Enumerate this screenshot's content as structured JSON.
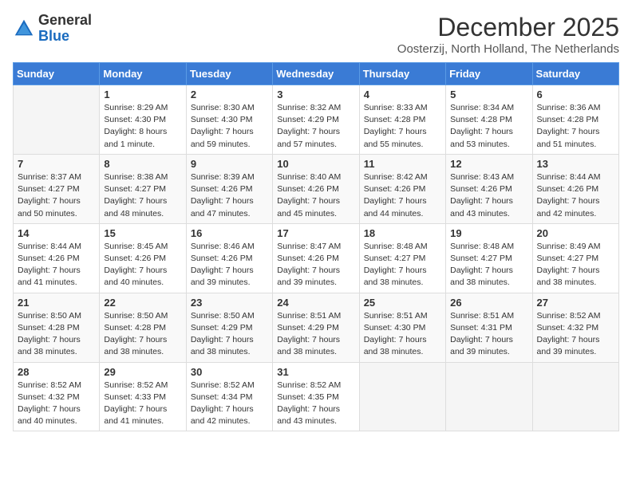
{
  "logo": {
    "general": "General",
    "blue": "Blue"
  },
  "header": {
    "month": "December 2025",
    "location": "Oosterzij, North Holland, The Netherlands"
  },
  "weekdays": [
    "Sunday",
    "Monday",
    "Tuesday",
    "Wednesday",
    "Thursday",
    "Friday",
    "Saturday"
  ],
  "weeks": [
    [
      {
        "day": "",
        "info": ""
      },
      {
        "day": "1",
        "info": "Sunrise: 8:29 AM\nSunset: 4:30 PM\nDaylight: 8 hours\nand 1 minute."
      },
      {
        "day": "2",
        "info": "Sunrise: 8:30 AM\nSunset: 4:30 PM\nDaylight: 7 hours\nand 59 minutes."
      },
      {
        "day": "3",
        "info": "Sunrise: 8:32 AM\nSunset: 4:29 PM\nDaylight: 7 hours\nand 57 minutes."
      },
      {
        "day": "4",
        "info": "Sunrise: 8:33 AM\nSunset: 4:28 PM\nDaylight: 7 hours\nand 55 minutes."
      },
      {
        "day": "5",
        "info": "Sunrise: 8:34 AM\nSunset: 4:28 PM\nDaylight: 7 hours\nand 53 minutes."
      },
      {
        "day": "6",
        "info": "Sunrise: 8:36 AM\nSunset: 4:28 PM\nDaylight: 7 hours\nand 51 minutes."
      }
    ],
    [
      {
        "day": "7",
        "info": "Sunrise: 8:37 AM\nSunset: 4:27 PM\nDaylight: 7 hours\nand 50 minutes."
      },
      {
        "day": "8",
        "info": "Sunrise: 8:38 AM\nSunset: 4:27 PM\nDaylight: 7 hours\nand 48 minutes."
      },
      {
        "day": "9",
        "info": "Sunrise: 8:39 AM\nSunset: 4:26 PM\nDaylight: 7 hours\nand 47 minutes."
      },
      {
        "day": "10",
        "info": "Sunrise: 8:40 AM\nSunset: 4:26 PM\nDaylight: 7 hours\nand 45 minutes."
      },
      {
        "day": "11",
        "info": "Sunrise: 8:42 AM\nSunset: 4:26 PM\nDaylight: 7 hours\nand 44 minutes."
      },
      {
        "day": "12",
        "info": "Sunrise: 8:43 AM\nSunset: 4:26 PM\nDaylight: 7 hours\nand 43 minutes."
      },
      {
        "day": "13",
        "info": "Sunrise: 8:44 AM\nSunset: 4:26 PM\nDaylight: 7 hours\nand 42 minutes."
      }
    ],
    [
      {
        "day": "14",
        "info": "Sunrise: 8:44 AM\nSunset: 4:26 PM\nDaylight: 7 hours\nand 41 minutes."
      },
      {
        "day": "15",
        "info": "Sunrise: 8:45 AM\nSunset: 4:26 PM\nDaylight: 7 hours\nand 40 minutes."
      },
      {
        "day": "16",
        "info": "Sunrise: 8:46 AM\nSunset: 4:26 PM\nDaylight: 7 hours\nand 39 minutes."
      },
      {
        "day": "17",
        "info": "Sunrise: 8:47 AM\nSunset: 4:26 PM\nDaylight: 7 hours\nand 39 minutes."
      },
      {
        "day": "18",
        "info": "Sunrise: 8:48 AM\nSunset: 4:27 PM\nDaylight: 7 hours\nand 38 minutes."
      },
      {
        "day": "19",
        "info": "Sunrise: 8:48 AM\nSunset: 4:27 PM\nDaylight: 7 hours\nand 38 minutes."
      },
      {
        "day": "20",
        "info": "Sunrise: 8:49 AM\nSunset: 4:27 PM\nDaylight: 7 hours\nand 38 minutes."
      }
    ],
    [
      {
        "day": "21",
        "info": "Sunrise: 8:50 AM\nSunset: 4:28 PM\nDaylight: 7 hours\nand 38 minutes."
      },
      {
        "day": "22",
        "info": "Sunrise: 8:50 AM\nSunset: 4:28 PM\nDaylight: 7 hours\nand 38 minutes."
      },
      {
        "day": "23",
        "info": "Sunrise: 8:50 AM\nSunset: 4:29 PM\nDaylight: 7 hours\nand 38 minutes."
      },
      {
        "day": "24",
        "info": "Sunrise: 8:51 AM\nSunset: 4:29 PM\nDaylight: 7 hours\nand 38 minutes."
      },
      {
        "day": "25",
        "info": "Sunrise: 8:51 AM\nSunset: 4:30 PM\nDaylight: 7 hours\nand 38 minutes."
      },
      {
        "day": "26",
        "info": "Sunrise: 8:51 AM\nSunset: 4:31 PM\nDaylight: 7 hours\nand 39 minutes."
      },
      {
        "day": "27",
        "info": "Sunrise: 8:52 AM\nSunset: 4:32 PM\nDaylight: 7 hours\nand 39 minutes."
      }
    ],
    [
      {
        "day": "28",
        "info": "Sunrise: 8:52 AM\nSunset: 4:32 PM\nDaylight: 7 hours\nand 40 minutes."
      },
      {
        "day": "29",
        "info": "Sunrise: 8:52 AM\nSunset: 4:33 PM\nDaylight: 7 hours\nand 41 minutes."
      },
      {
        "day": "30",
        "info": "Sunrise: 8:52 AM\nSunset: 4:34 PM\nDaylight: 7 hours\nand 42 minutes."
      },
      {
        "day": "31",
        "info": "Sunrise: 8:52 AM\nSunset: 4:35 PM\nDaylight: 7 hours\nand 43 minutes."
      },
      {
        "day": "",
        "info": ""
      },
      {
        "day": "",
        "info": ""
      },
      {
        "day": "",
        "info": ""
      }
    ]
  ]
}
